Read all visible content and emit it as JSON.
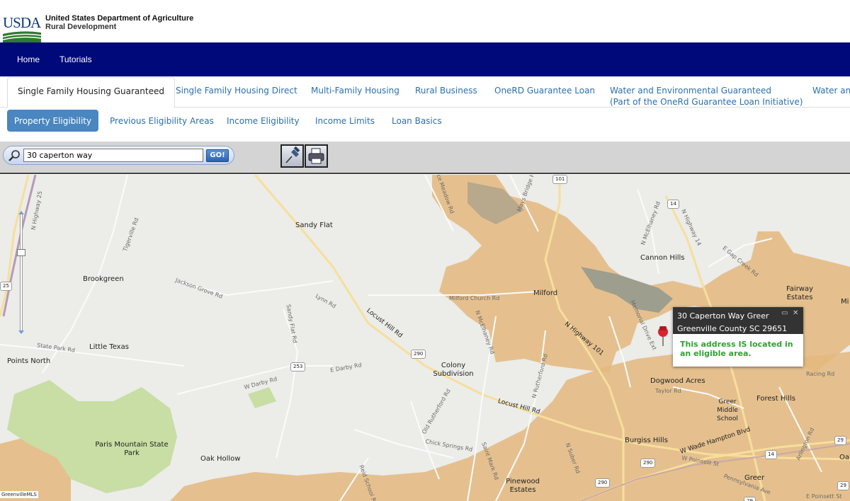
{
  "header": {
    "logo_text": "USDA",
    "agency_line1": "United States Department of Agriculture",
    "agency_line2": "Rural Development"
  },
  "topnav": {
    "home": "Home",
    "tutorials": "Tutorials"
  },
  "program_tabs": [
    {
      "label": "Single Family Housing Guaranteed"
    },
    {
      "label": "Single Family Housing Direct"
    },
    {
      "label": "Multi-Family Housing"
    },
    {
      "label": "Rural Business"
    },
    {
      "label": "OneRD Guarantee Loan"
    },
    {
      "label": "Water and Environmental Guaranteed",
      "sub": "(Part of the OneRd Guarantee Loan Initiative)"
    },
    {
      "label": "Water and"
    }
  ],
  "sub_tabs": [
    {
      "label": "Property Eligibility"
    },
    {
      "label": "Previous Eligibility Areas"
    },
    {
      "label": "Income Eligibility"
    },
    {
      "label": "Income Limits"
    },
    {
      "label": "Loan Basics"
    }
  ],
  "search": {
    "value": "30 caperton way",
    "go_label": "GO!"
  },
  "map": {
    "places": [
      "Sandy Flat",
      "Brookgreen",
      "Cannon Hills",
      "Milford",
      "Fairway Estates",
      "Little Texas",
      "Points North",
      "Colony Subdivision",
      "Dogwood Acres",
      "Forest Hills",
      "Greer Middle School",
      "Paris Mountain State Park",
      "Oak Hollow",
      "Burgiss Hills",
      "Pinewood Estates",
      "Greer",
      "Taylor Rd",
      "Mi",
      "Oak"
    ],
    "roads": [
      "N Highway 25",
      "Tigerville Rd",
      "Jackson Grove Rd",
      "Lynn Rd",
      "Locust Hill Rd",
      "Milford Church Rd",
      "Sandy Flat Rd",
      "N McElhaney Rd",
      "N Highway 101",
      "N McElhaney Rd",
      "N Highway 14",
      "E Gap Creek Rd",
      "Memorial Drive Ext",
      "State Park Rd",
      "W Darby Rd",
      "E Darby Rd",
      "Old Rutherford Rd",
      "N Rutherford Rd",
      "Locust Hill Rd",
      "Chick Springs Rd",
      "Saint Mark Rd",
      "W Wade Hampton Blvd",
      "Arlington Rd",
      "N Suber Rd",
      "W Poinsett St",
      "Pennsylvania Ave",
      "Reid School Rd",
      "Mays Bridge Rd",
      "Groce Meadow Rd",
      "Racing Rd",
      "E Poinsett St"
    ],
    "shields": [
      "101",
      "14",
      "25",
      "290",
      "253",
      "290",
      "14",
      "290",
      "29",
      "29",
      "29"
    ]
  },
  "popup": {
    "line1": "30 Caperton Way Greer",
    "line2": "Greenville County SC 29651",
    "message": "This address IS located in an eligible area."
  },
  "footer": {
    "mls": "GreenvilleMLS"
  },
  "colors": {
    "nav": "#00097a",
    "eligible": "#2fa232",
    "ineligible_area": "#e4b97e",
    "park": "#c8dea4"
  }
}
